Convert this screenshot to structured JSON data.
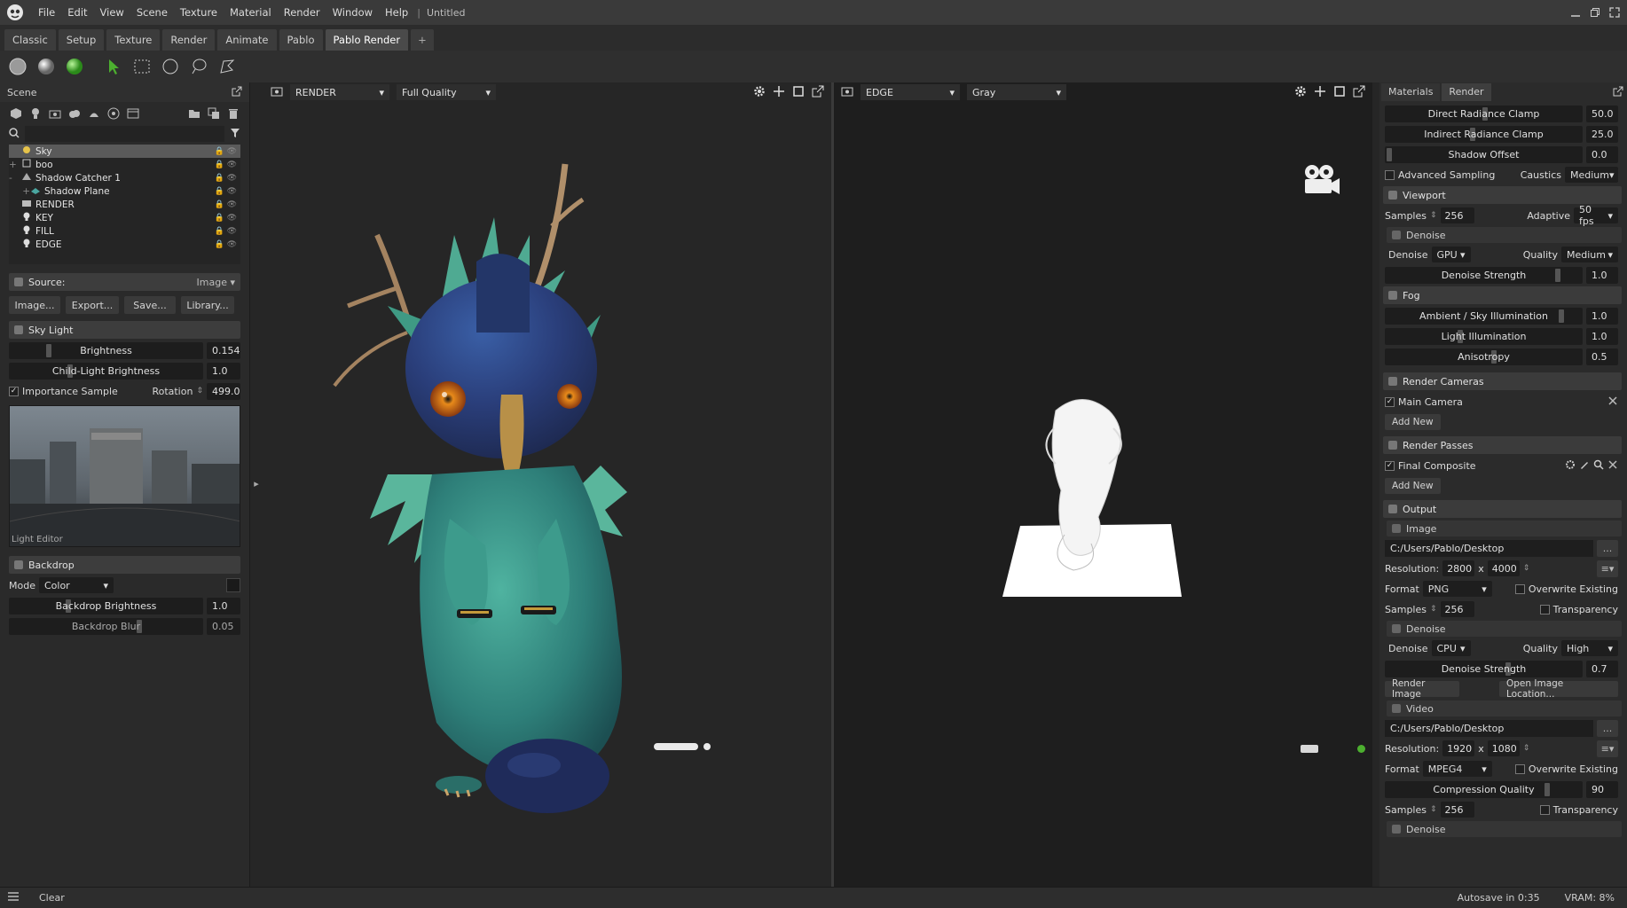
{
  "app": {
    "title": "Untitled"
  },
  "menu": [
    "File",
    "Edit",
    "View",
    "Scene",
    "Texture",
    "Material",
    "Render",
    "Window",
    "Help"
  ],
  "tabs": [
    "Classic",
    "Setup",
    "Texture",
    "Render",
    "Animate",
    "Pablo",
    "Pablo Render",
    "+"
  ],
  "active_tab": "Pablo Render",
  "scene": {
    "header": "Scene",
    "tree": [
      {
        "name": "Sky",
        "icon": "sky-icon",
        "selected": true
      },
      {
        "name": "boo",
        "icon": "object-icon"
      },
      {
        "name": "Shadow Catcher 1",
        "icon": "shadow-catcher-icon"
      },
      {
        "name": "Shadow Plane",
        "icon": "plane-icon"
      },
      {
        "name": "RENDER",
        "icon": "camera-icon"
      },
      {
        "name": "KEY",
        "icon": "light-icon"
      },
      {
        "name": "FILL",
        "icon": "light-icon"
      },
      {
        "name": "EDGE",
        "icon": "light-icon"
      }
    ]
  },
  "source": {
    "label": "Source:",
    "mode": "Image",
    "buttons": [
      "Image...",
      "Export...",
      "Save...",
      "Library..."
    ]
  },
  "sky_light": {
    "title": "Sky Light",
    "brightness_label": "Brightness",
    "brightness": "0.154",
    "child_label": "Child-Light Brightness",
    "child": "1.0",
    "importance_label": "Importance Sample",
    "rotation_label": "Rotation",
    "rotation": "499.0",
    "caption": "Light Editor"
  },
  "backdrop": {
    "title": "Backdrop",
    "mode_label": "Mode",
    "mode": "Color",
    "brightness_label": "Backdrop Brightness",
    "brightness": "1.0",
    "blur_label": "Backdrop Blur",
    "blur": "0.05"
  },
  "viewport_left": {
    "camera": "RENDER",
    "quality": "Full Quality"
  },
  "viewport_right": {
    "camera": "EDGE",
    "shading": "Gray"
  },
  "right_panel": {
    "tabs": [
      "Materials",
      "Render"
    ],
    "direct_clamp_label": "Direct Radiance Clamp",
    "direct_clamp": "50.0",
    "indirect_clamp_label": "Indirect Radiance Clamp",
    "indirect_clamp": "25.0",
    "shadow_offset_label": "Shadow Offset",
    "shadow_offset": "0.0",
    "adv_label": "Advanced Sampling",
    "caustics_label": "Caustics",
    "caustics": "Medium",
    "viewport": {
      "title": "Viewport",
      "samples_label": "Samples",
      "samples": "256",
      "adaptive_label": "Adaptive",
      "fps": "50 fps",
      "denoise_section": "Denoise",
      "denoise_label": "Denoise",
      "denoise": "GPU",
      "quality_label": "Quality",
      "quality": "Medium",
      "strength_label": "Denoise Strength",
      "strength": "1.0"
    },
    "fog": {
      "title": "Fog",
      "ambient_label": "Ambient / Sky Illumination",
      "ambient": "1.0",
      "light_label": "Light Illumination",
      "light": "1.0",
      "aniso_label": "Anisotropy",
      "aniso": "0.5"
    },
    "cameras": {
      "title": "Render Cameras",
      "item": "Main Camera",
      "add": "Add New"
    },
    "passes": {
      "title": "Render Passes",
      "item": "Final Composite",
      "add": "Add New"
    },
    "output": {
      "title": "Output",
      "image": {
        "title": "Image",
        "path": "C:/Users/Pablo/Desktop",
        "res_label": "Resolution:",
        "res_w": "2800",
        "x": "x",
        "res_h": "4000",
        "format_label": "Format",
        "format": "PNG",
        "overwrite_label": "Overwrite Existing",
        "samples_label": "Samples",
        "samples": "256",
        "transparency_label": "Transparency",
        "denoise_section": "Denoise",
        "denoise_label": "Denoise",
        "denoise": "CPU",
        "quality_label": "Quality",
        "quality": "High",
        "strength_label": "Denoise Strength",
        "strength": "0.7",
        "render_btn": "Render Image",
        "open_btn": "Open Image Location..."
      },
      "video": {
        "title": "Video",
        "path": "C:/Users/Pablo/Desktop",
        "res_label": "Resolution:",
        "res_w": "1920",
        "x": "x",
        "res_h": "1080",
        "format_label": "Format",
        "format": "MPEG4",
        "overwrite_label": "Overwrite Existing",
        "compression_label": "Compression Quality",
        "compression": "90",
        "samples_label": "Samples",
        "samples": "256",
        "transparency_label": "Transparency",
        "denoise_section": "Denoise"
      }
    },
    "dots": "..."
  },
  "status": {
    "clear": "Clear",
    "autosave": "Autosave in 0:35",
    "vram": "VRAM: 8%"
  },
  "colors": {
    "accent_green": "#4caf2f",
    "selection": "#5a5a5a"
  }
}
